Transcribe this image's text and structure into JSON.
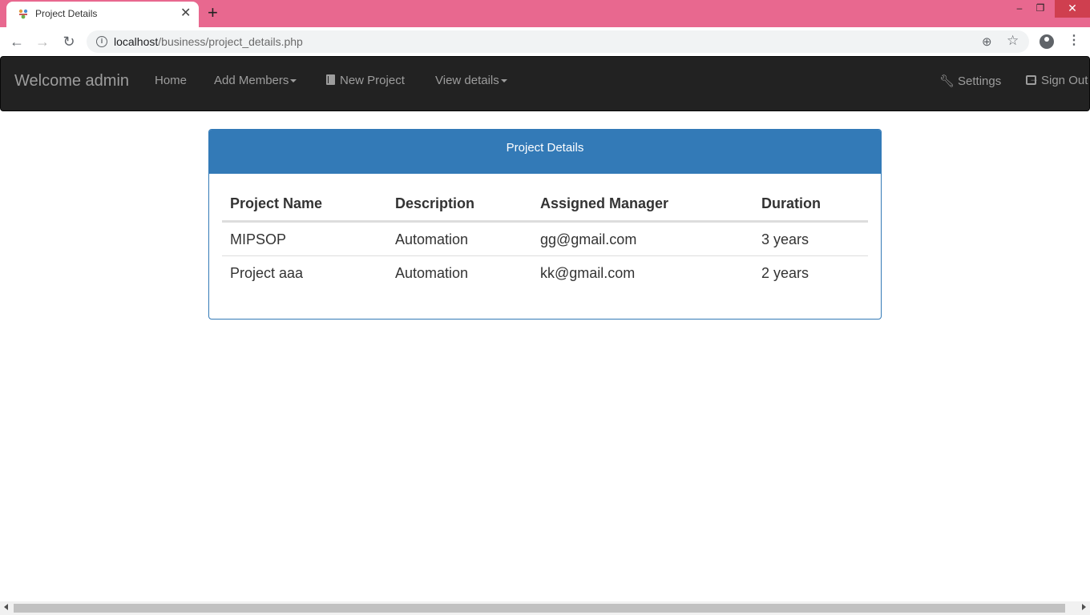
{
  "browser": {
    "tab_title": "Project Details",
    "tab_close": "✕",
    "new_tab": "+",
    "url_host": "localhost",
    "url_path": "/business/project_details.php",
    "window_controls": {
      "minimize": "–",
      "maximize": "❐",
      "close": "✕"
    }
  },
  "navbar": {
    "brand": "Welcome admin",
    "items": [
      {
        "label": "Home"
      },
      {
        "label": "Add Members",
        "dropdown": true
      },
      {
        "label": "New Project",
        "icon": "book-icon"
      },
      {
        "label": "View details",
        "dropdown": true
      }
    ],
    "right_items": [
      {
        "label": "Settings",
        "icon": "wrench-icon"
      },
      {
        "label": "Sign Out",
        "icon": "log-out-icon"
      }
    ]
  },
  "panel": {
    "title": "Project Details",
    "columns": [
      "Project Name",
      "Description",
      "Assigned Manager",
      "Duration"
    ],
    "rows": [
      [
        "MIPSOP",
        "Automation",
        "gg@gmail.com",
        "3 years"
      ],
      [
        "Project aaa",
        "Automation",
        "kk@gmail.com",
        "2 years"
      ]
    ]
  },
  "colors": {
    "titlebar": "#e8688f",
    "navbar_bg": "#222222",
    "panel_primary": "#337ab7"
  }
}
